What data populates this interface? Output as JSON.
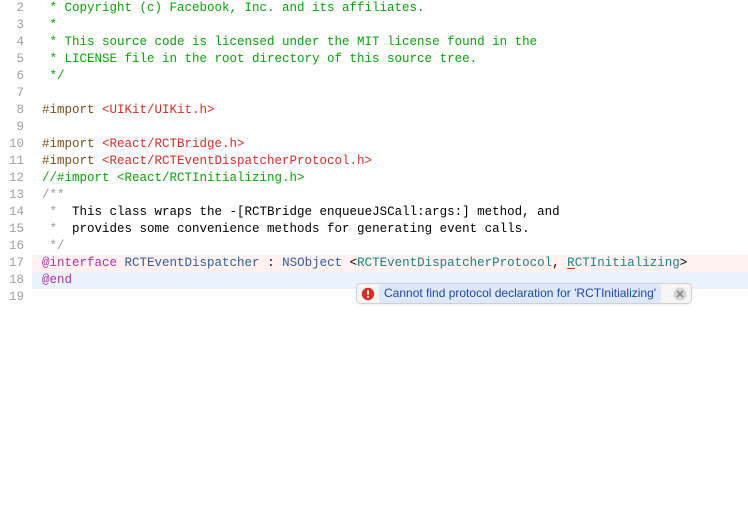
{
  "lines": [
    {
      "n": 2,
      "cls": "",
      "spans": [
        {
          "t": " * Copyright (c) Facebook, Inc. and its affiliates.",
          "c": "c-comment"
        }
      ]
    },
    {
      "n": 3,
      "cls": "",
      "spans": [
        {
          "t": " *",
          "c": "c-comment"
        }
      ]
    },
    {
      "n": 4,
      "cls": "",
      "spans": [
        {
          "t": " * This source code is licensed under the MIT license found in the",
          "c": "c-comment"
        }
      ]
    },
    {
      "n": 5,
      "cls": "",
      "spans": [
        {
          "t": " * LICENSE file in the root directory of this source tree.",
          "c": "c-comment"
        }
      ]
    },
    {
      "n": 6,
      "cls": "",
      "spans": [
        {
          "t": " */",
          "c": "c-comment"
        }
      ]
    },
    {
      "n": 7,
      "cls": "",
      "spans": []
    },
    {
      "n": 8,
      "cls": "",
      "spans": [
        {
          "t": "#import ",
          "c": "c-directive"
        },
        {
          "t": "<UIKit/UIKit.h>",
          "c": "c-string"
        }
      ]
    },
    {
      "n": 9,
      "cls": "",
      "spans": []
    },
    {
      "n": 10,
      "cls": "",
      "spans": [
        {
          "t": "#import ",
          "c": "c-directive"
        },
        {
          "t": "<React/RCTBridge.h>",
          "c": "c-string"
        }
      ]
    },
    {
      "n": 11,
      "cls": "",
      "spans": [
        {
          "t": "#import ",
          "c": "c-directive"
        },
        {
          "t": "<React/RCTEventDispatcherProtocol.h>",
          "c": "c-string"
        }
      ]
    },
    {
      "n": 12,
      "cls": "",
      "spans": [
        {
          "t": "//#import <React/RCTInitializing.h>",
          "c": "c-comment"
        }
      ]
    },
    {
      "n": 13,
      "cls": "",
      "spans": [
        {
          "t": "/**",
          "c": "c-doc"
        }
      ]
    },
    {
      "n": 14,
      "cls": "",
      "spans": [
        {
          "t": " *  ",
          "c": "c-doc"
        },
        {
          "t": "This class wraps the -[RCTBridge enqueueJSCall:args:] method, and",
          "c": ""
        }
      ]
    },
    {
      "n": 15,
      "cls": "",
      "spans": [
        {
          "t": " *  ",
          "c": "c-doc"
        },
        {
          "t": "provides some convenience methods for generating event calls.",
          "c": ""
        }
      ]
    },
    {
      "n": 16,
      "cls": "",
      "spans": [
        {
          "t": " */",
          "c": "c-doc"
        }
      ]
    },
    {
      "n": 17,
      "cls": "error-line",
      "spans": [
        {
          "t": "@interface",
          "c": "c-keyword"
        },
        {
          "t": " ",
          "c": ""
        },
        {
          "t": "RCTEventDispatcher",
          "c": "c-class"
        },
        {
          "t": " : ",
          "c": ""
        },
        {
          "t": "NSObject",
          "c": "c-class"
        },
        {
          "t": " <",
          "c": ""
        },
        {
          "t": "RCTEventDispatcherProtocol",
          "c": "c-type"
        },
        {
          "t": ", ",
          "c": ""
        },
        {
          "t": "R",
          "c": "c-type err-underline"
        },
        {
          "t": "CTInitializing",
          "c": "c-type"
        },
        {
          "t": ">",
          "c": ""
        }
      ]
    },
    {
      "n": 18,
      "cls": "highlight-line",
      "spans": [
        {
          "t": "@end",
          "c": "c-keyword"
        }
      ]
    },
    {
      "n": 19,
      "cls": "",
      "spans": []
    }
  ],
  "error": {
    "message": "Cannot find protocol declaration for 'RCTInitializing'"
  }
}
